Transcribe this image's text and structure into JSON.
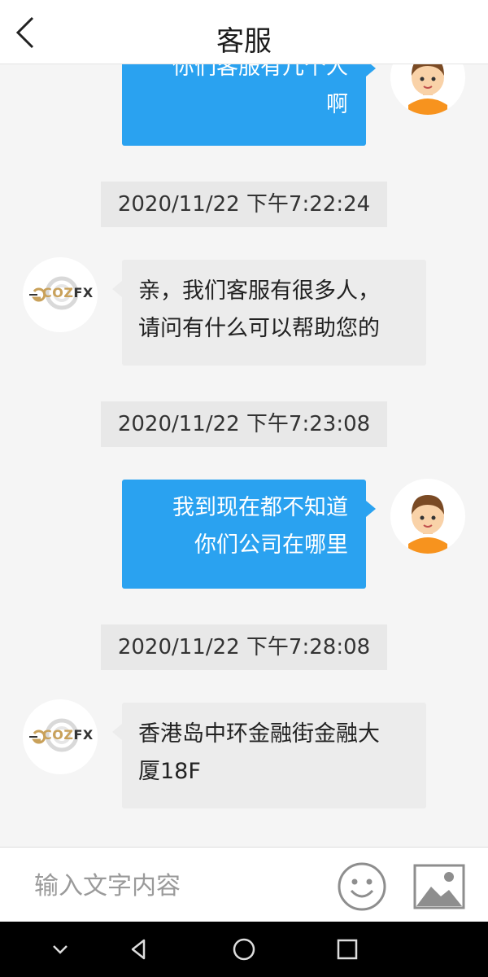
{
  "header": {
    "title": "客服"
  },
  "messages": [
    {
      "type": "sent",
      "lines": [
        "你们客服有几个人",
        "啊"
      ]
    },
    {
      "type": "time",
      "text": "2020/11/22 下午7:22:24"
    },
    {
      "type": "received",
      "lines": [
        "亲，我们客服有很多人，",
        "请问有什么可以帮助您的"
      ]
    },
    {
      "type": "time",
      "text": "2020/11/22 下午7:23:08"
    },
    {
      "type": "sent",
      "lines": [
        "我到现在都不知道",
        "你们公司在哪里"
      ]
    },
    {
      "type": "time",
      "text": "2020/11/22 下午7:28:08"
    },
    {
      "type": "received",
      "lines": [
        "香港岛中环金融街金融大",
        "厦18F"
      ]
    }
  ],
  "agent_logo": {
    "brand_a": "COZ",
    "brand_b": "FX"
  },
  "input": {
    "placeholder": "输入文字内容",
    "value": ""
  },
  "icons": {
    "back": "chevron-left-icon",
    "emoji": "smiley-icon",
    "image": "image-icon",
    "nav": [
      "chevron-down-icon",
      "triangle-back-icon",
      "circle-home-icon",
      "square-recents-icon"
    ]
  },
  "colors": {
    "sent_bubble": "#2aa2f0",
    "received_bubble": "#ececec",
    "accent_gold": "#c9a15a"
  }
}
